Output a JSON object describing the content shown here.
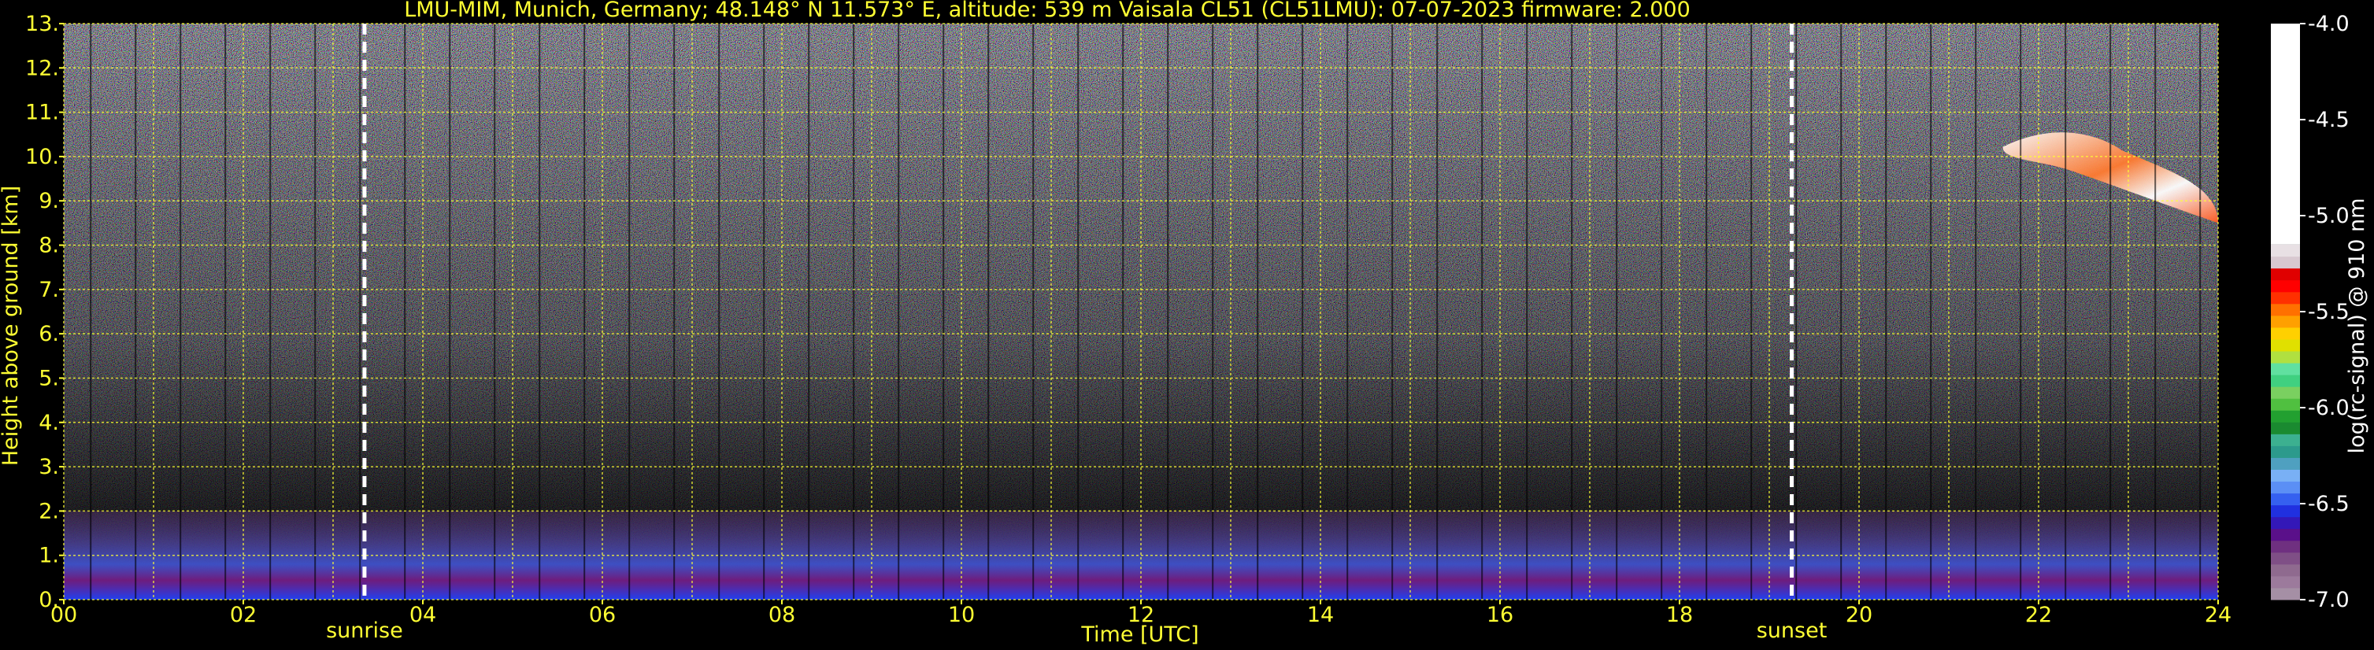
{
  "chart_data": {
    "type": "heatmap",
    "title": "LMU-MIM, Munich, Germany; 48.148° N 11.573° E, altitude: 539 m    Vaisala CL51 (CL51LMU): 07-07-2023    firmware: 2.000",
    "xlabel": "Time [UTC]",
    "ylabel": "Height above ground [km]",
    "xlim": [
      0,
      24
    ],
    "ylim": [
      0,
      13
    ],
    "x_ticks": [
      {
        "value": 0,
        "label": "00"
      },
      {
        "value": 2,
        "label": "02"
      },
      {
        "value": 4,
        "label": "04"
      },
      {
        "value": 6,
        "label": "06"
      },
      {
        "value": 8,
        "label": "08"
      },
      {
        "value": 10,
        "label": "10"
      },
      {
        "value": 12,
        "label": "12"
      },
      {
        "value": 14,
        "label": "14"
      },
      {
        "value": 16,
        "label": "16"
      },
      {
        "value": 18,
        "label": "18"
      },
      {
        "value": 20,
        "label": "20"
      },
      {
        "value": 22,
        "label": "22"
      },
      {
        "value": 24,
        "label": "24"
      }
    ],
    "y_ticks": [
      {
        "value": 0,
        "label": "0."
      },
      {
        "value": 1,
        "label": "1."
      },
      {
        "value": 2,
        "label": "2."
      },
      {
        "value": 3,
        "label": "3."
      },
      {
        "value": 4,
        "label": "4."
      },
      {
        "value": 5,
        "label": "5."
      },
      {
        "value": 6,
        "label": "6."
      },
      {
        "value": 7,
        "label": "7."
      },
      {
        "value": 8,
        "label": "8."
      },
      {
        "value": 9,
        "label": "9."
      },
      {
        "value": 10,
        "label": "10."
      },
      {
        "value": 11,
        "label": "11."
      },
      {
        "value": 12,
        "label": "12."
      },
      {
        "value": 13,
        "label": "13."
      }
    ],
    "grid": true,
    "grid_color": "#ffff33",
    "events": [
      {
        "name": "sunrise",
        "time": 3.35
      },
      {
        "name": "sunset",
        "time": 19.25
      }
    ],
    "colorbar": {
      "label": "log(rc-signal) @ 910 nm",
      "range": [
        -7.0,
        -4.0
      ],
      "ticks": [
        {
          "value": -4.0,
          "label": "-4.0"
        },
        {
          "value": -4.5,
          "label": "-4.5"
        },
        {
          "value": -5.0,
          "label": "-5.0"
        },
        {
          "value": -5.5,
          "label": "-5.5"
        },
        {
          "value": -6.0,
          "label": "-6.0"
        },
        {
          "value": -6.5,
          "label": "-6.5"
        },
        {
          "value": -7.0,
          "label": "-7.0"
        }
      ],
      "colors_bottom_to_top": [
        "#a58fa5",
        "#9c7a9c",
        "#8f6a8f",
        "#7f4f86",
        "#6f3080",
        "#5a108a",
        "#3318b8",
        "#2030e0",
        "#3560f0",
        "#5b8ff5",
        "#79b0f5",
        "#4fa0c0",
        "#2c9a8c",
        "#3cb090",
        "#1a8a30",
        "#22a030",
        "#50c040",
        "#7ad060",
        "#40d080",
        "#60e0a0",
        "#b0e040",
        "#e0e000",
        "#ffd000",
        "#ffa000",
        "#ff7000",
        "#ff3000",
        "#ff0000",
        "#e00000",
        "#d8c8d0",
        "#e8e0e4",
        "#ffffff"
      ]
    },
    "signal_features": [
      {
        "name": "boundary-layer",
        "time_range": [
          0,
          24
        ],
        "height_km": [
          0,
          2.0
        ],
        "log_signal": -6.5
      },
      {
        "name": "cirrus-cloud",
        "time_range": [
          21.6,
          24
        ],
        "height_km": [
          8.5,
          10.7
        ],
        "log_signal": -4.5
      }
    ]
  }
}
